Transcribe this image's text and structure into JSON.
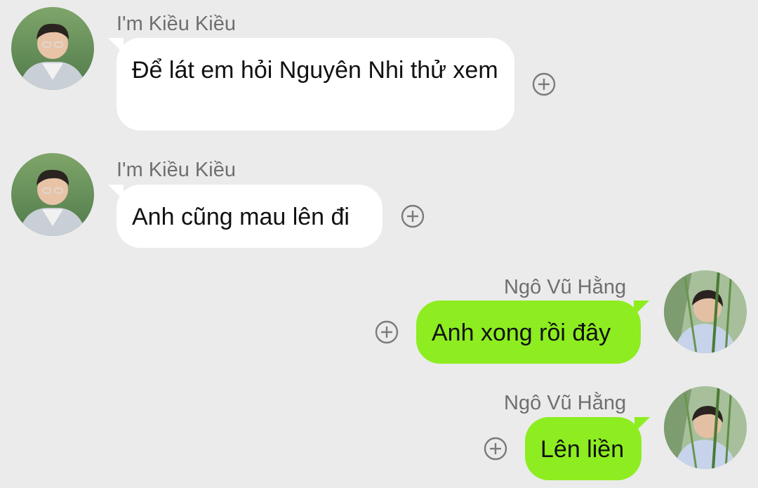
{
  "messages": [
    {
      "sender": "I'm Kiều Kiều",
      "text": "Để lát em hỏi Nguyên Nhi thử xem",
      "direction": "incoming",
      "avatar_icon": "avatar-kieu-kieu"
    },
    {
      "sender": "I'm Kiều Kiều",
      "text": "Anh cũng mau lên đi",
      "direction": "incoming",
      "avatar_icon": "avatar-kieu-kieu"
    },
    {
      "sender": "Ngô Vũ Hằng",
      "text": "Anh xong rồi đây",
      "direction": "outgoing",
      "avatar_icon": "avatar-ngo-vu-hang"
    },
    {
      "sender": "Ngô Vũ Hằng",
      "text": "Lên liền",
      "direction": "outgoing",
      "avatar_icon": "avatar-ngo-vu-hang"
    }
  ],
  "colors": {
    "background": "#ebebeb",
    "incoming_bubble": "#ffffff",
    "outgoing_bubble": "#8ded21",
    "sender_text": "#6f6f6f",
    "react_icon": "#7a7a7a"
  },
  "icons": {
    "react": "add-reaction-icon"
  }
}
